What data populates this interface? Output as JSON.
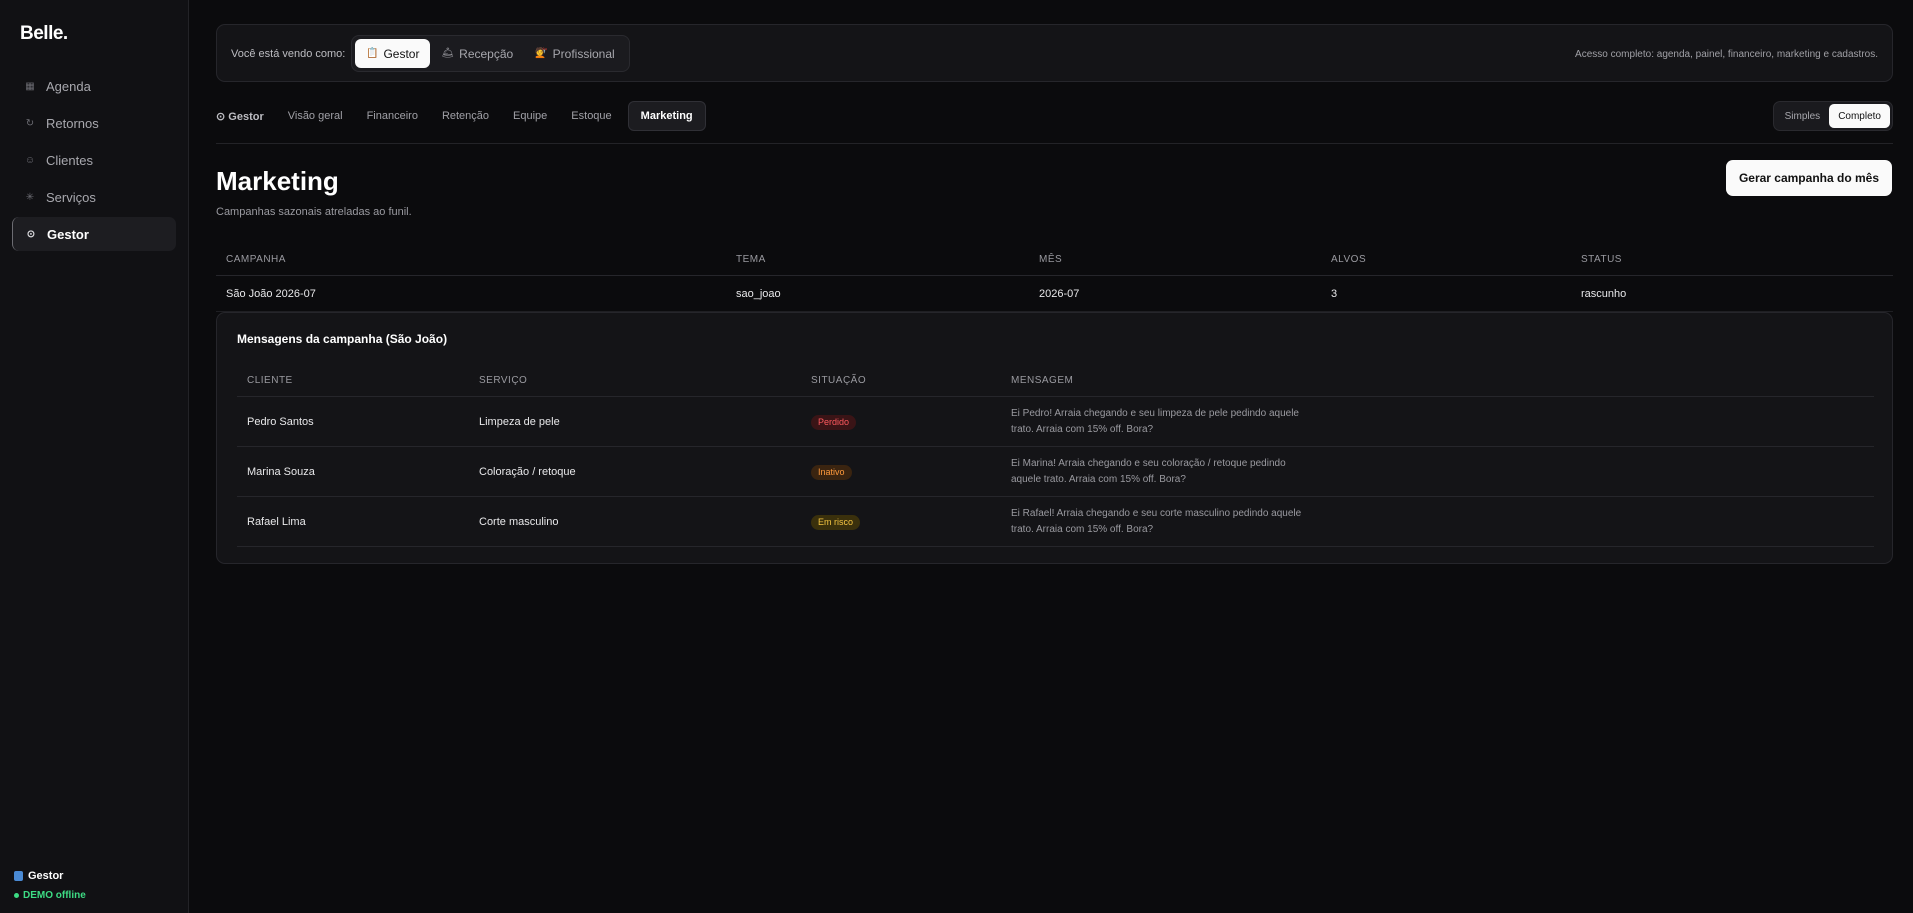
{
  "sidebar": {
    "brand": "Belle.",
    "items": [
      {
        "label": "Agenda",
        "icon": "calendar-icon",
        "glyph": "▦"
      },
      {
        "label": "Retornos",
        "icon": "refresh-icon",
        "glyph": "↻"
      },
      {
        "label": "Clientes",
        "icon": "user-icon",
        "glyph": "☺"
      },
      {
        "label": "Serviços",
        "icon": "sparkle-icon",
        "glyph": "✳"
      },
      {
        "label": "Gestor",
        "icon": "gauge-icon",
        "glyph": "⊙"
      }
    ],
    "active_index": 4,
    "footer_role": "Gestor",
    "footer_status": "DEMO offline"
  },
  "topbar": {
    "viewing_label": "Você está vendo como:",
    "roles": [
      {
        "label": "Gestor",
        "emoji": "📋"
      },
      {
        "label": "Recepção",
        "emoji": "🛎"
      },
      {
        "label": "Profissional",
        "emoji": "💇"
      }
    ],
    "active_role": 0,
    "access_text": "Acesso completo: agenda, painel, financeiro, marketing e cadastros."
  },
  "tabs": {
    "section_label": "⊙ Gestor",
    "items": [
      "Visão geral",
      "Financeiro",
      "Retenção",
      "Equipe",
      "Estoque",
      "Marketing"
    ],
    "active": "Marketing"
  },
  "mode": {
    "options": [
      "Simples",
      "Completo"
    ],
    "active": "Completo"
  },
  "header": {
    "title": "Marketing",
    "subtitle": "Campanhas sazonais atreladas ao funil.",
    "generate_button": "Gerar campanha do mês"
  },
  "campaigns": {
    "columns": [
      "CAMPANHA",
      "TEMA",
      "MÊS",
      "ALVOS",
      "STATUS"
    ],
    "rows": [
      [
        "São João 2026-07",
        "sao_joao",
        "2026-07",
        "3",
        "rascunho"
      ]
    ]
  },
  "messages": {
    "title": "Mensagens da campanha (São João)",
    "columns": [
      "CLIENTE",
      "SERVIÇO",
      "SITUAÇÃO",
      "MENSAGEM"
    ],
    "rows": [
      {
        "cliente": "Pedro Santos",
        "servico": "Limpeza de pele",
        "situacao": "Perdido",
        "badge_bg": "#3a1416",
        "badge_fg": "#ff5a5f",
        "mensagem": "Ei Pedro! Arraia chegando e seu limpeza de pele pedindo aquele trato. Arraia com 15% off. Bora?"
      },
      {
        "cliente": "Marina Souza",
        "servico": "Coloração / retoque",
        "situacao": "Inativo",
        "badge_bg": "#3a2410",
        "badge_fg": "#ff9a3d",
        "mensagem": "Ei Marina! Arraia chegando e seu coloração / retoque pedindo aquele trato. Arraia com 15% off. Bora?"
      },
      {
        "cliente": "Rafael Lima",
        "servico": "Corte masculino",
        "situacao": "Em risco",
        "badge_bg": "#3a300c",
        "badge_fg": "#f5c542",
        "mensagem": "Ei Rafael! Arraia chegando e seu corte masculino pedindo aquele trato. Arraia com 15% off. Bora?"
      }
    ]
  },
  "colors": {
    "background": "#0b0b0d",
    "sidebar": "#111114",
    "accent_status": "#3ddc84"
  }
}
